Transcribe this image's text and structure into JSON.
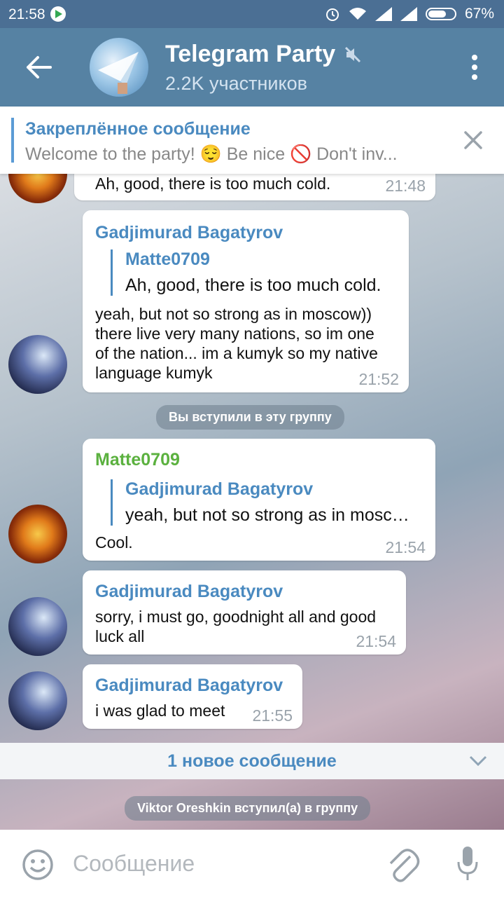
{
  "status": {
    "time": "21:58",
    "battery": "67%"
  },
  "header": {
    "title": "Telegram Party",
    "subtitle": "2.2K участников"
  },
  "pinned": {
    "title": "Закреплённое сообщение",
    "text": "Welcome to the party! 😌 Be nice 🚫 Don't inv..."
  },
  "messages": [
    {
      "text": "Ah, good, there is too much cold.",
      "time": "21:48"
    },
    {
      "sender": "Gadjimurad Bagatyrov",
      "reply_name": "Matte0709",
      "reply_text": "Ah, good, there is too much cold.",
      "lines": [
        "yeah, but not so strong as in moscow))",
        "there live very many nations, so im one",
        "of the nation... im a kumyk so my native",
        "language kumyk"
      ],
      "time": "21:52"
    },
    {
      "service": "Вы вступили в эту группу"
    },
    {
      "sender": "Matte0709",
      "reply_name": "Gadjimurad Bagatyrov",
      "reply_text": "yeah, but not so strong as in mosc…",
      "text": "Cool.",
      "time": "21:54"
    },
    {
      "sender": "Gadjimurad Bagatyrov",
      "lines": [
        "sorry, i must go, goodnight all and good",
        "luck all"
      ],
      "time": "21:54"
    },
    {
      "sender": "Gadjimurad Bagatyrov",
      "text": "i was glad to meet",
      "time": "21:55"
    }
  ],
  "new_messages": "1 новое сообщение",
  "service_bottom": "Viktor Oreshkin вступил(а) в группу",
  "input": {
    "placeholder": "Сообщение"
  },
  "colors": {
    "header": "#5682a3",
    "statusbar": "#4b6f94",
    "accent": "#4a8ac0",
    "green_name": "#5bb13f"
  }
}
